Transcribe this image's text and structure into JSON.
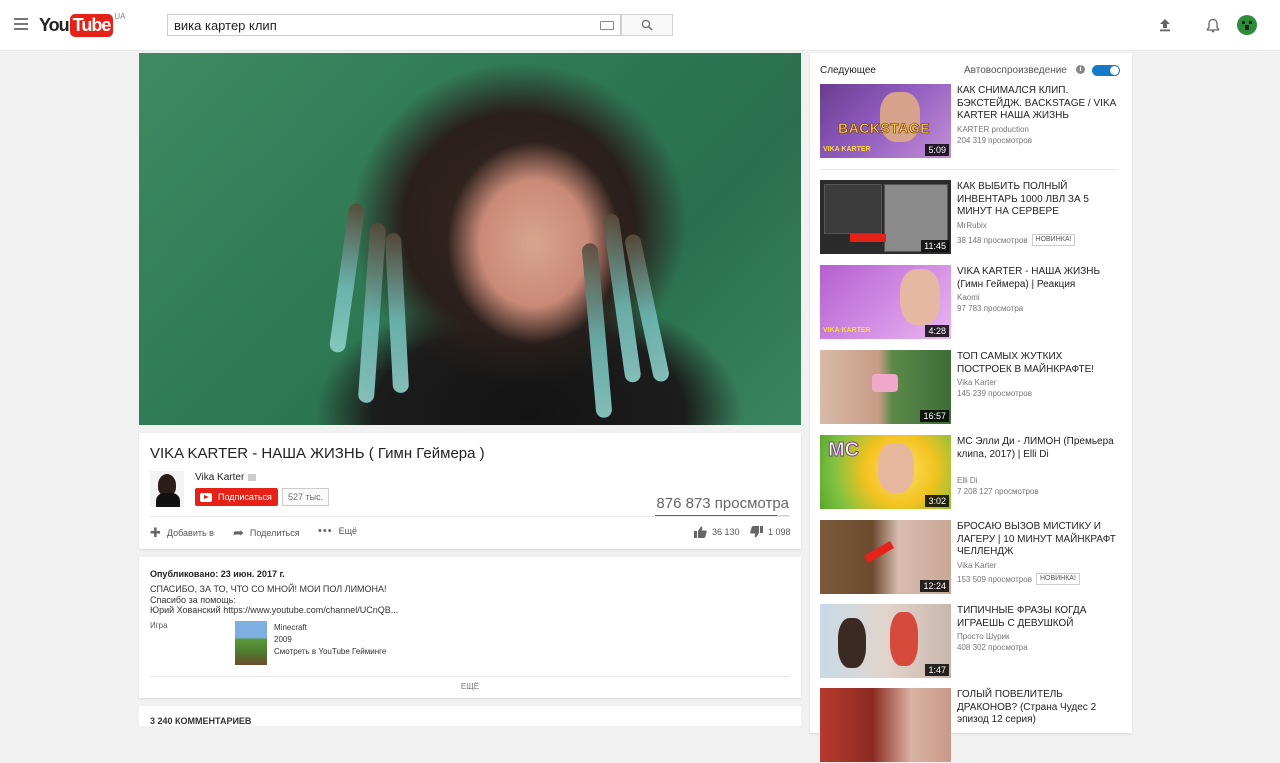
{
  "header": {
    "logo_you": "You",
    "logo_tube": "Tube",
    "logo_region": "UA",
    "search_query": "вика картер клип"
  },
  "video": {
    "title": "VIKA KARTER - НАША ЖИЗНЬ ( Гимн Геймера )",
    "channel": "Vika Karter",
    "subscribe_label": "Подписаться",
    "subscriber_count": "527 тыс.",
    "views": "876 873 просмотра",
    "like_ratio": 0.91,
    "add_to_label": "Добавить в",
    "share_label": "Поделиться",
    "more_label": "Ещё",
    "likes": "36 130",
    "dislikes": "1 098"
  },
  "description": {
    "published": "Опубликовано: 23 июн. 2017 г.",
    "lines": [
      "СПАСИБО, ЗА ТО, ЧТО СО МНОЙ! МОИ ПОЛ ЛИМОНА!",
      "Спасибо за помощь:",
      "Юрий Хованский https://www.youtube.com/channel/UCnQB..."
    ],
    "game_label": "Игра",
    "game_name": "Minecraft",
    "game_year": "2009",
    "game_link": "Смотреть в YouTube Гейминге",
    "show_more": "ЕЩЁ"
  },
  "comments": {
    "heading": "3 240 КОММЕНТАРИЕВ"
  },
  "sidebar": {
    "up_next": "Следующее",
    "autoplay": "Автовоспроизведение",
    "autoplay_on": true,
    "items": [
      {
        "title": "КАК СНИМАЛСЯ КЛИП. БЭКСТЕЙДЖ. BACKSTAGE / VIKA KARTER НАША ЖИЗНЬ",
        "channel": "KARTER production",
        "views": "204 319 просмотров",
        "duration": "5:09",
        "badge": "",
        "thumb_text": "BACKSTAGE",
        "thumb_sub": "VIKA KARTER"
      },
      {
        "title": "КАК ВЫБИТЬ ПОЛНЫЙ ИНВЕНТАРЬ 1000 ЛВЛ ЗА 5 МИНУТ НА СЕРВЕРЕ",
        "channel": "MrRubix",
        "views": "38 148 просмотров",
        "duration": "11:45",
        "badge": "НОВИНКА!",
        "thumb_text": "",
        "thumb_sub": ""
      },
      {
        "title": "VIKA KARTER - НАША ЖИЗНЬ (Гимн Геймера) | Реакция",
        "channel": "Kaomi",
        "views": "97 783 просмотра",
        "duration": "4:28",
        "badge": "",
        "thumb_text": "",
        "thumb_sub": "VIKA KARTER"
      },
      {
        "title": "ТОП САМЫХ ЖУТКИХ ПОСТРОЕК В МАЙНКРАФТЕ!",
        "channel": "Vika Karter",
        "views": "145 239 просмотров",
        "duration": "16:57",
        "badge": "",
        "thumb_text": "",
        "thumb_sub": ""
      },
      {
        "title": "MC Элли Ди - ЛИМОН (Премьера клипа, 2017) | Elli Di",
        "channel": "Elli Di",
        "views": "7 208 127 просмотров",
        "duration": "3:02",
        "badge": "",
        "thumb_text": "MC",
        "thumb_sub": ""
      },
      {
        "title": "БРОСАЮ ВЫЗОВ МИСТИКУ И ЛАГЕРУ | 10 МИНУТ МАЙНКРАФТ ЧЕЛЛЕНДЖ",
        "channel": "Vika Karter",
        "views": "153 509 просмотров",
        "duration": "12:24",
        "badge": "НОВИНКА!",
        "thumb_text": "",
        "thumb_sub": ""
      },
      {
        "title": "ТИПИЧНЫЕ ФРАЗЫ КОГДА ИГРАЕШЬ С ДЕВУШКОЙ",
        "channel": "Просто Шурик",
        "views": "408 302 просмотра",
        "duration": "1:47",
        "badge": "",
        "thumb_text": "",
        "thumb_sub": ""
      },
      {
        "title": "ГОЛЫЙ ПОВЕЛИТЕЛЬ ДРАКОНОВ? (Страна Чудес 2 эпизод 12 серия)",
        "channel": "",
        "views": "",
        "duration": "",
        "badge": "",
        "thumb_text": "",
        "thumb_sub": ""
      }
    ]
  }
}
